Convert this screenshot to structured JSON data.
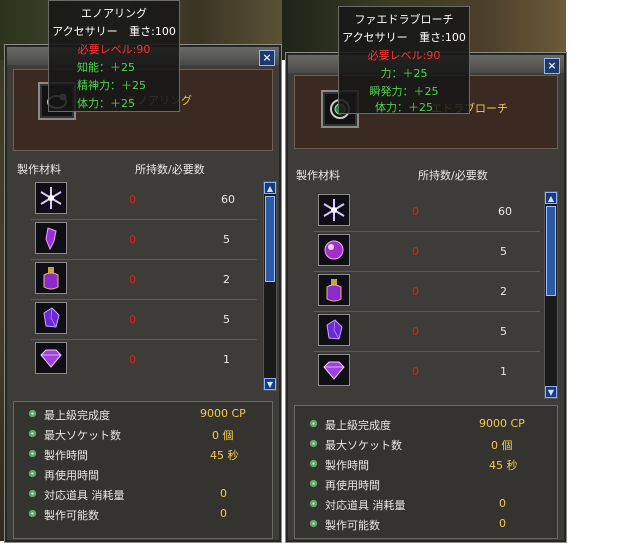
{
  "windows": [
    {
      "item_name": "エノアリング",
      "header_name_partial": "エノアリング",
      "tooltip": {
        "title": "エノアリング",
        "category": "アクセサリー",
        "weight_label": "重さ",
        "weight": "100",
        "required_level_label": "必要レベル",
        "required_level": "90",
        "bonuses": [
          "知能：＋25",
          "精神力：＋25",
          "体力：＋25"
        ]
      },
      "columns": {
        "materials": "製作材料",
        "counts": "所持数/必要数"
      },
      "materials": [
        {
          "icon": "snowflake-crystal-icon",
          "have": "0",
          "need": "60"
        },
        {
          "icon": "purple-shard-icon",
          "have": "0",
          "need": "5"
        },
        {
          "icon": "potion-flask-icon",
          "have": "0",
          "need": "2"
        },
        {
          "icon": "purple-gem-icon",
          "have": "0",
          "need": "5"
        },
        {
          "icon": "amethyst-diamond-icon",
          "have": "0",
          "need": "1"
        }
      ],
      "stats": [
        {
          "label": "最上級完成度",
          "value": "9000 CP"
        },
        {
          "label": "最大ソケット数",
          "value": "0 個"
        },
        {
          "label": "製作時間",
          "value": "45 秒"
        },
        {
          "label": "再使用時間",
          "value": ""
        },
        {
          "label": "対応道具 消耗量",
          "value": "0"
        },
        {
          "label": "製作可能数",
          "value": "0"
        }
      ]
    },
    {
      "item_name": "ファエドラブローチ",
      "header_name_partial": "エドラブローチ",
      "tooltip": {
        "title": "ファエドラブローチ",
        "category": "アクセサリー",
        "weight_label": "重さ",
        "weight": "100",
        "required_level_label": "必要レベル",
        "required_level": "90",
        "bonuses": [
          "力：＋25",
          "瞬発力：＋25",
          "体力：＋25"
        ]
      },
      "columns": {
        "materials": "製作材料",
        "counts": "所持数/必要数"
      },
      "materials": [
        {
          "icon": "snowflake-crystal-icon",
          "have": "0",
          "need": "60"
        },
        {
          "icon": "purple-orb-icon",
          "have": "0",
          "need": "5"
        },
        {
          "icon": "potion-flask-icon",
          "have": "0",
          "need": "2"
        },
        {
          "icon": "purple-gem-icon",
          "have": "0",
          "need": "5"
        },
        {
          "icon": "amethyst-diamond-icon",
          "have": "0",
          "need": "1"
        }
      ],
      "stats": [
        {
          "label": "最上級完成度",
          "value": "9000 CP"
        },
        {
          "label": "最大ソケット数",
          "value": "0 個"
        },
        {
          "label": "製作時間",
          "value": "45 秒"
        },
        {
          "label": "再使用時間",
          "value": ""
        },
        {
          "label": "対応道具 消耗量",
          "value": "0"
        },
        {
          "label": "製作可能数",
          "value": "0"
        }
      ]
    }
  ],
  "colors": {
    "required_level": "#ff3030",
    "bonus": "#4cd44c",
    "value": "#f2c94c",
    "have_count": "#e02020"
  }
}
